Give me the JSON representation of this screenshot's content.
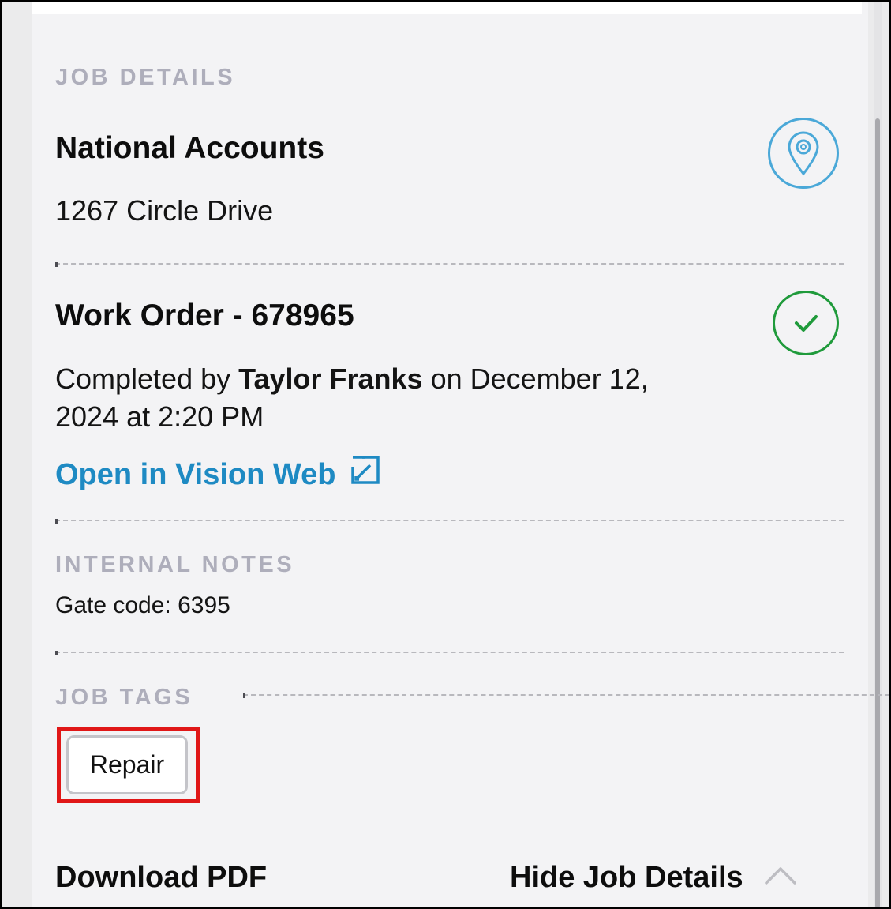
{
  "job_details": {
    "section_label": "JOB DETAILS",
    "account_name": "National Accounts",
    "address": "1267 Circle Drive",
    "location_icon": "map-pin-icon"
  },
  "work_order": {
    "title": "Work Order - 678965",
    "status_icon": "check-circle-icon",
    "completed_prefix": "Completed by",
    "completed_by": "Taylor Franks",
    "completed_on_prefix": "on December 12,",
    "completed_on_rest": "2024 at 2:20 PM",
    "open_link_label": "Open in Vision Web",
    "open_link_icon": "external-link-icon"
  },
  "internal_notes": {
    "section_label": "INTERNAL NOTES",
    "note": "Gate code: 6395"
  },
  "job_tags": {
    "section_label": "JOB TAGS",
    "tags": [
      "Repair"
    ]
  },
  "footer": {
    "download_label": "Download PDF",
    "hide_details_label": "Hide Job Details",
    "hide_icon": "chevron-up-icon"
  },
  "colors": {
    "accent": "#1e8ac3",
    "location_icon": "#4aa8d8",
    "status_complete": "#1f9a3b",
    "highlight": "#e01717"
  }
}
